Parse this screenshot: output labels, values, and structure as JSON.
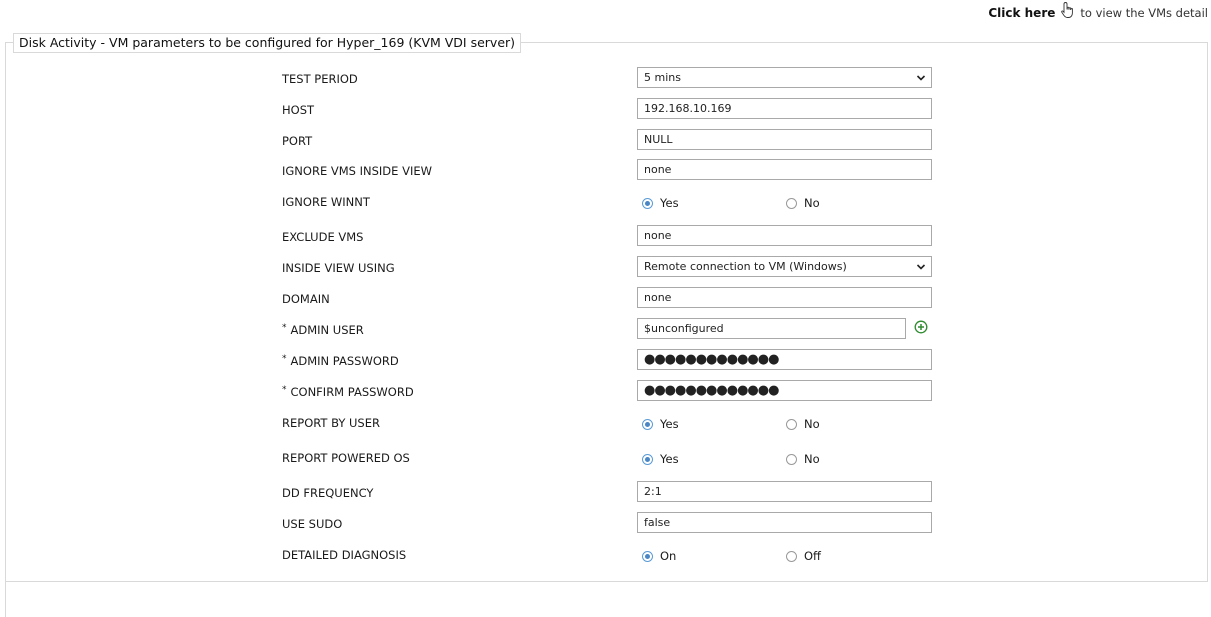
{
  "header": {
    "click_here": "Click here",
    "click_here_suffix": "to view the VMs detail"
  },
  "legend": "Disk Activity - VM parameters to be configured for Hyper_169 (KVM VDI server)",
  "fields": {
    "test_period": {
      "label": "TEST PERIOD",
      "value": "5 mins"
    },
    "host": {
      "label": "HOST",
      "value": "192.168.10.169"
    },
    "port": {
      "label": "PORT",
      "value": "NULL"
    },
    "ignore_vms_inside_view": {
      "label": "IGNORE VMS INSIDE VIEW",
      "value": "none"
    },
    "ignore_winnt": {
      "label": "IGNORE WINNT",
      "opt1": "Yes",
      "opt2": "No",
      "selected": "Yes"
    },
    "exclude_vms": {
      "label": "EXCLUDE VMS",
      "value": "none"
    },
    "inside_view_using": {
      "label": "INSIDE VIEW USING",
      "value": "Remote connection to VM (Windows)"
    },
    "domain": {
      "label": "DOMAIN",
      "value": "none"
    },
    "admin_user": {
      "label": "ADMIN USER",
      "req": "*",
      "value": "$unconfigured"
    },
    "admin_password": {
      "label": "ADMIN PASSWORD",
      "req": "*",
      "value": "●●●●●●●●●●●●●"
    },
    "confirm_password": {
      "label": "CONFIRM PASSWORD",
      "req": "*",
      "value": "●●●●●●●●●●●●●"
    },
    "report_by_user": {
      "label": "REPORT BY USER",
      "opt1": "Yes",
      "opt2": "No",
      "selected": "Yes"
    },
    "report_powered_os": {
      "label": "REPORT POWERED OS",
      "opt1": "Yes",
      "opt2": "No",
      "selected": "Yes"
    },
    "dd_frequency": {
      "label": "DD FREQUENCY",
      "value": "2:1"
    },
    "use_sudo": {
      "label": "USE SUDO",
      "value": "false"
    },
    "detailed_diagnosis": {
      "label": "DETAILED DIAGNOSIS",
      "opt1": "On",
      "opt2": "Off",
      "selected": "On"
    }
  },
  "colors": {
    "radio_selected": "#4a86c5",
    "add_icon": "#2e8b2e",
    "border": "#a9a9a9"
  }
}
